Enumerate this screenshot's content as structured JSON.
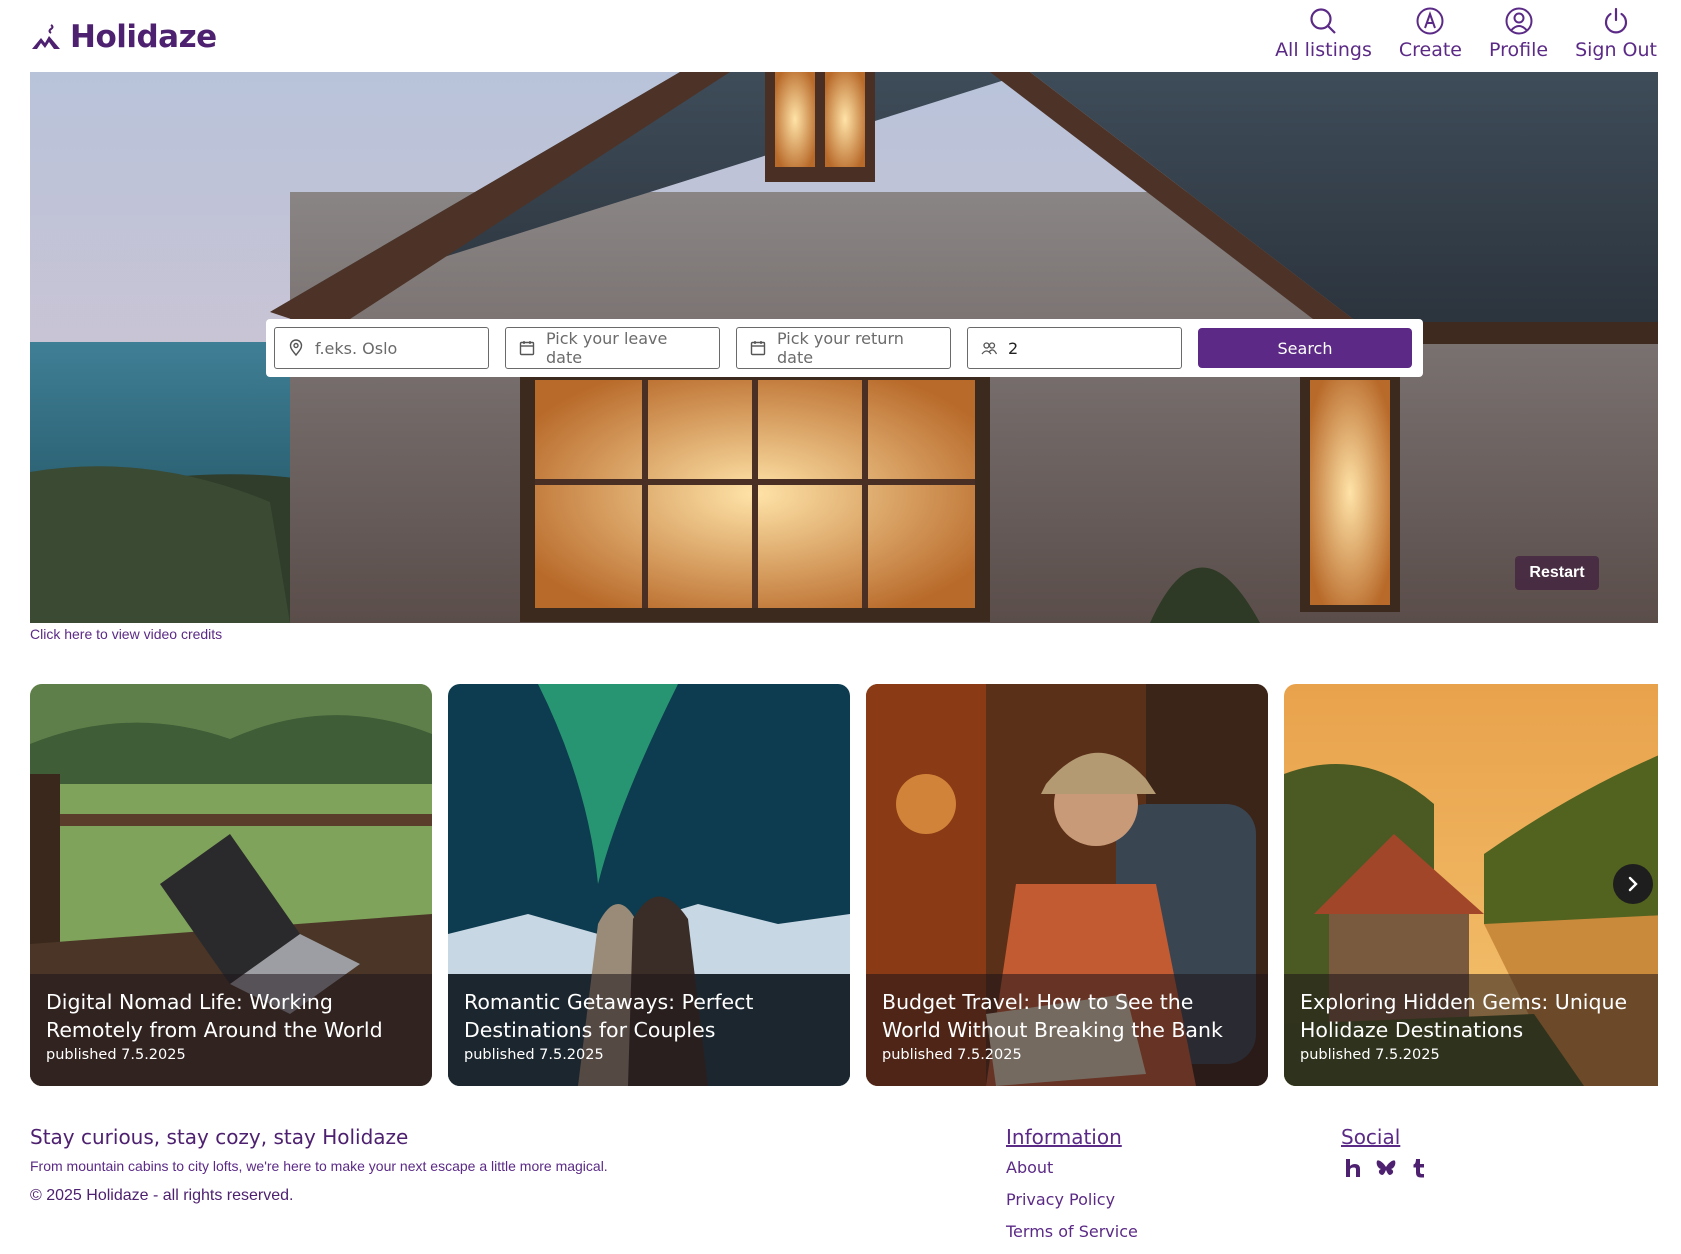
{
  "brand": {
    "name": "Holidaze",
    "color": "#4e2170"
  },
  "nav": {
    "items": [
      {
        "label": "All listings",
        "icon": "search-icon"
      },
      {
        "label": "Create",
        "icon": "create-icon"
      },
      {
        "label": "Profile",
        "icon": "profile-icon"
      },
      {
        "label": "Sign Out",
        "icon": "power-icon"
      }
    ]
  },
  "search": {
    "location_placeholder": "f.eks. Oslo",
    "leave_placeholder": "Pick your leave date",
    "return_placeholder": "Pick your return date",
    "guests_value": "2",
    "button_label": "Search"
  },
  "hero": {
    "restart_label": "Restart",
    "credits_link": "Click here to view video credits"
  },
  "cards": [
    {
      "title": "Digital Nomad Life: Working Remotely from Around the World",
      "date": "published 7.5.2025"
    },
    {
      "title": "Romantic Getaways: Perfect Destinations for Couples",
      "date": "published 7.5.2025"
    },
    {
      "title": "Budget Travel: How to See the World Without Breaking the Bank",
      "date": "published 7.5.2025"
    },
    {
      "title": "Exploring Hidden Gems: Unique Holidaze Destinations",
      "date": "published 7.5.2025"
    }
  ],
  "footer": {
    "title": "Stay curious, stay cozy, stay Holidaze",
    "tagline": "From mountain cabins to city lofts, we're here to make your next escape a little more magical.",
    "copyright": "© 2025 Holidaze - all rights reserved.",
    "information": {
      "heading": "Information",
      "links": [
        "About",
        "Privacy Policy",
        "Terms of Service"
      ]
    },
    "social": {
      "heading": "Social",
      "icons": [
        "holidaze-h-icon",
        "bluesky-icon",
        "tumblr-icon"
      ]
    }
  },
  "colors": {
    "accent": "#5c2a86",
    "text": "#4e2170"
  }
}
